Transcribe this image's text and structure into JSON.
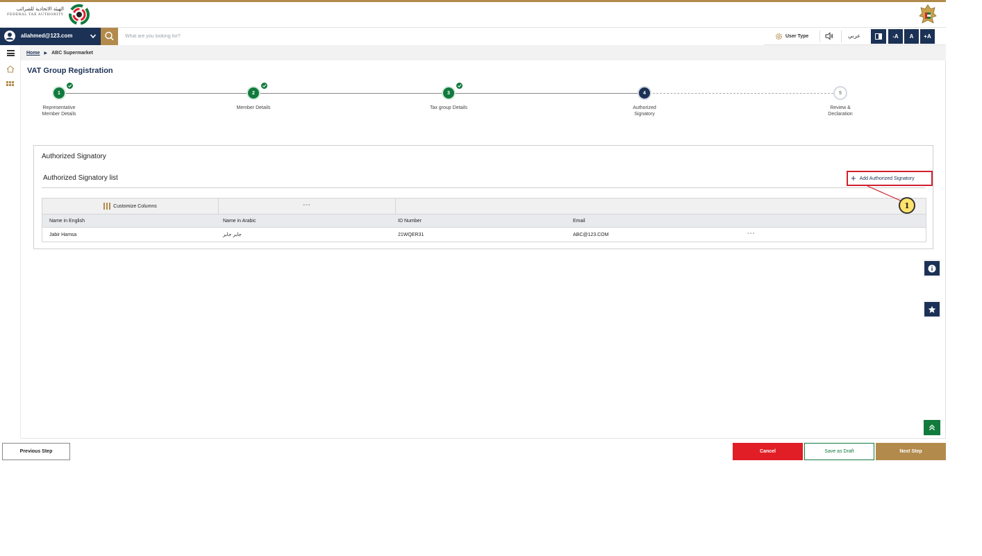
{
  "header": {
    "logo_arabic": "الهيئة الاتحادية للضرائب",
    "logo_english": "FEDERAL TAX AUTHORITY"
  },
  "nav": {
    "user_email": "aliahmed@123.com",
    "search_placeholder": "What are you looking for?",
    "user_type_label": "User Type",
    "arabic_link": "عربي",
    "font_smaller": "-A",
    "font_normal": "A",
    "font_larger": "+A"
  },
  "breadcrumb": {
    "home": "Home",
    "current": "ABC Supermarket"
  },
  "page": {
    "title": "VAT Group Registration"
  },
  "steps": [
    {
      "number": "1",
      "label_line1": "Representative",
      "label_line2": "Member Details",
      "status": "completed"
    },
    {
      "number": "2",
      "label_line1": "Member Details",
      "label_line2": "",
      "status": "completed"
    },
    {
      "number": "3",
      "label_line1": "Tax group Details",
      "label_line2": "",
      "status": "completed"
    },
    {
      "number": "4",
      "label_line1": "Authorized",
      "label_line2": "Signatory",
      "status": "active"
    },
    {
      "number": "5",
      "label_line1": "Review &",
      "label_line2": "Declaration",
      "status": "pending"
    }
  ],
  "card": {
    "title": "Authorized Signatory",
    "list_title": "Authorized Signatory list",
    "add_button": "Add Authorized Signatory",
    "annotation_number": "1"
  },
  "table": {
    "customize_label": "Customize Columns",
    "toolbar_dots": "°°°",
    "columns": [
      "Name in English",
      "Name in Arabic",
      "ID Number",
      "Email"
    ],
    "rows": [
      {
        "name_en": "Jabir Hamsa",
        "name_ar": "جابر جابر",
        "id_number": "21WQER31",
        "email": "ABC@123.COM",
        "actions": "°°°"
      }
    ]
  },
  "footer": {
    "previous": "Previous Step",
    "cancel": "Cancel",
    "save_draft": "Save as Draft",
    "next": "Next Step"
  },
  "colors": {
    "navy": "#1b3155",
    "gold": "#b28b4c",
    "green": "#117a3d",
    "red": "#e11d26"
  }
}
